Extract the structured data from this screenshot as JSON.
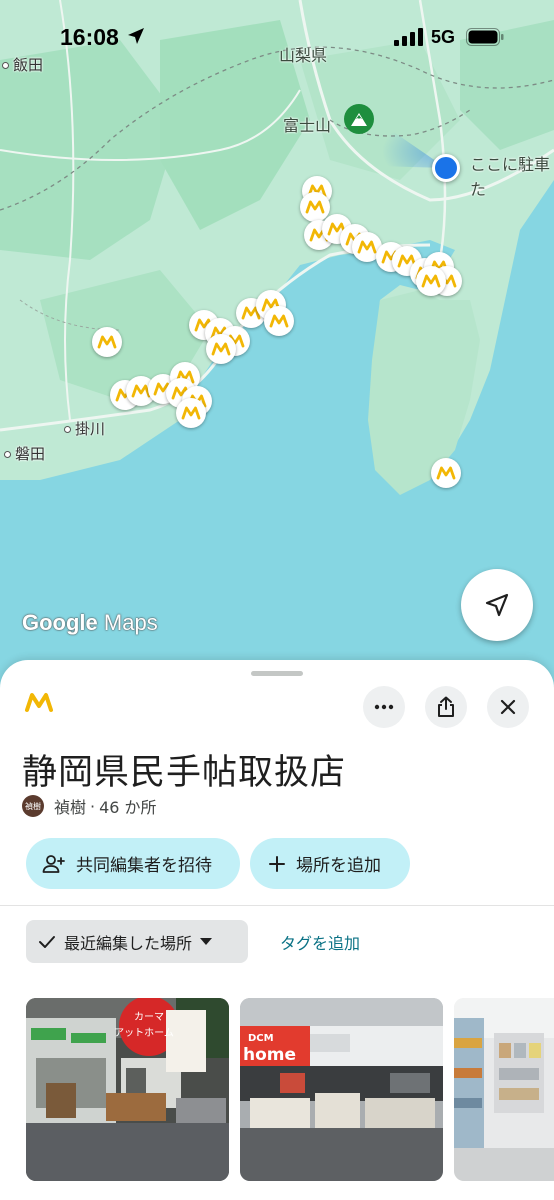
{
  "status_bar": {
    "time": "16:08",
    "network": "5G"
  },
  "map": {
    "labels": {
      "iida": "飯田",
      "yamanashi": "山梨県",
      "fujisan": "富士山",
      "parking_line1": "ここに駐車",
      "parking_line2": "た",
      "kakegawa": "掛川",
      "iwata": "磐田"
    },
    "logo_google": "Google",
    "logo_maps": "Maps",
    "colors": {
      "sea": "#86d6e2",
      "land": "#bfe9d4",
      "forest": "#a6e0c0",
      "pin_icon": "#f2b705",
      "location_dot": "#1a73e8",
      "mountain_pin": "#1e8e3e"
    }
  },
  "sheet": {
    "title": "静岡県民手帖取扱店",
    "owner_avatar": "禎樹",
    "owner": "禎樹",
    "separator": "·",
    "count": "46 か所",
    "invite_label": "共同編集者を招待",
    "add_place_label": "場所を追加",
    "sort_label": "最近編集した場所",
    "add_tag_label": "タグを追加",
    "photos": [
      {
        "sign_line1": "カーマ",
        "sign_line2": "アットホーム"
      },
      {
        "sign_brand": "DCM",
        "sign_line": "home"
      },
      {}
    ],
    "icons": [
      "list-logo-icon",
      "more-icon",
      "share-icon",
      "close-icon",
      "add-person-icon",
      "plus-icon",
      "check-icon",
      "dropdown-icon"
    ]
  }
}
